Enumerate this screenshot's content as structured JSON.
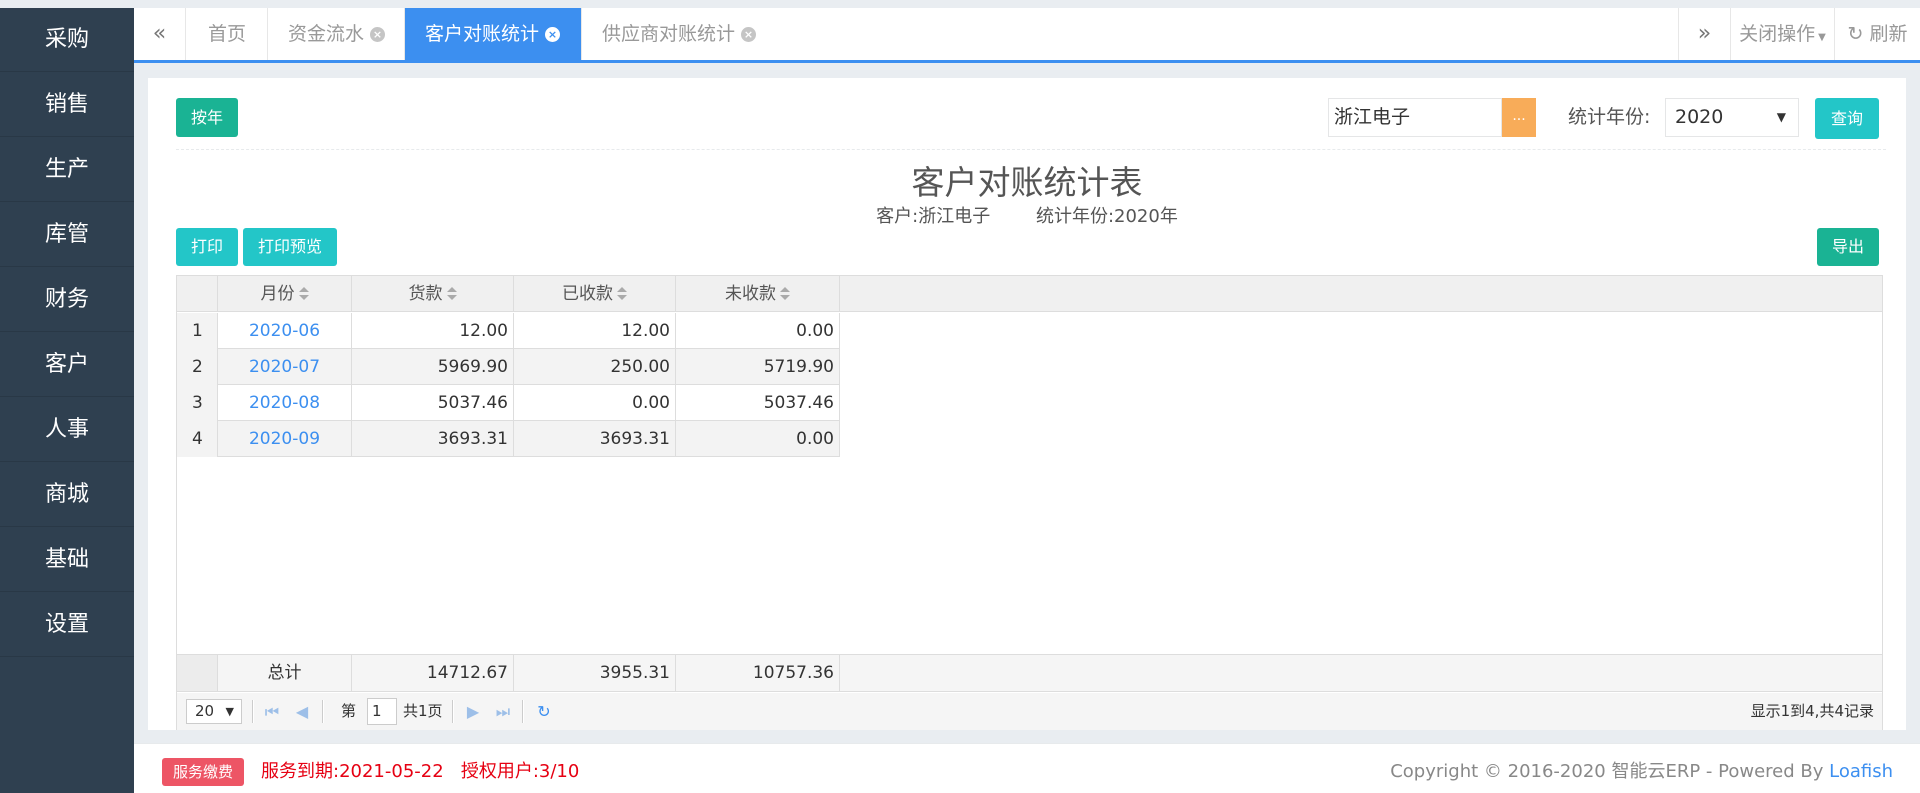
{
  "sidebar": {
    "items": [
      {
        "label": "采购"
      },
      {
        "label": "销售"
      },
      {
        "label": "生产"
      },
      {
        "label": "库管"
      },
      {
        "label": "财务"
      },
      {
        "label": "客户"
      },
      {
        "label": "人事"
      },
      {
        "label": "商城"
      },
      {
        "label": "基础"
      },
      {
        "label": "设置"
      }
    ]
  },
  "tabs": {
    "items": [
      {
        "label": "首页"
      },
      {
        "label": "资金流水"
      },
      {
        "label": "客户对账统计"
      },
      {
        "label": "供应商对账统计"
      }
    ],
    "close_ops": "关闭操作",
    "refresh": "刷新"
  },
  "toolbar": {
    "by_year": "按年",
    "customer_value": "浙江电子",
    "customer_trigger": "...",
    "year_label": "统计年份:",
    "year_value": "2020",
    "query": "查询"
  },
  "report": {
    "title": "客户对账统计表",
    "customer_label": "客户:浙江电子",
    "year_label": "统计年份:2020年"
  },
  "actions": {
    "print": "打印",
    "print_preview": "打印预览",
    "export": "导出"
  },
  "table": {
    "columns": [
      "月份",
      "货款",
      "已收款",
      "未收款"
    ],
    "rows": [
      {
        "no": "1",
        "month": "2020-06",
        "amount": "12.00",
        "received": "12.00",
        "unreceived": "0.00"
      },
      {
        "no": "2",
        "month": "2020-07",
        "amount": "5969.90",
        "received": "250.00",
        "unreceived": "5719.90"
      },
      {
        "no": "3",
        "month": "2020-08",
        "amount": "5037.46",
        "received": "0.00",
        "unreceived": "5037.46"
      },
      {
        "no": "4",
        "month": "2020-09",
        "amount": "3693.31",
        "received": "3693.31",
        "unreceived": "0.00"
      }
    ],
    "total": {
      "label": "总计",
      "amount": "14712.67",
      "received": "3955.31",
      "unreceived": "10757.36"
    }
  },
  "pager": {
    "page_size": "20",
    "page_prefix": "第",
    "page_value": "1",
    "page_total": "共1页",
    "summary": "显示1到4,共4记录"
  },
  "footer": {
    "badge": "服务缴费",
    "expire": "服务到期:2021-05-22",
    "users": "授权用户:3/10",
    "copyright": "Copyright © 2016-2020 智能云ERP - Powered By",
    "powered_link": "Loafish"
  },
  "colors": {
    "sidebar": "#2f4050",
    "accent": "#3c8ff0",
    "green": "#1ab394",
    "cyan": "#23c6c8",
    "orange": "#f8ac59",
    "danger": "#ed5565"
  }
}
